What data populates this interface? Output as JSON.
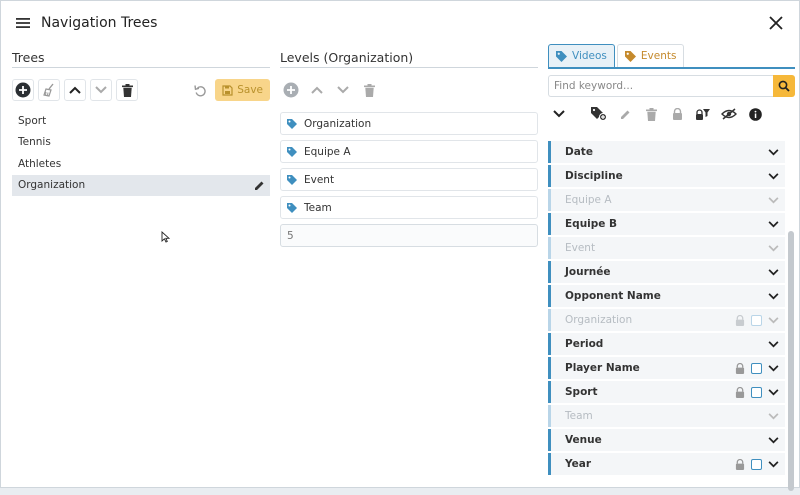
{
  "window": {
    "title": "Navigation Trees"
  },
  "trees": {
    "title": "Trees",
    "save_label": "Save",
    "items": [
      {
        "label": "Sport"
      },
      {
        "label": "Tennis"
      },
      {
        "label": "Athletes"
      },
      {
        "label": "Organization",
        "selected": true
      }
    ]
  },
  "levels": {
    "title": "Levels (Organization)",
    "items": [
      {
        "label": "Organization"
      },
      {
        "label": "Equipe A"
      },
      {
        "label": "Event"
      },
      {
        "label": "Team"
      }
    ],
    "next_input_value": "5"
  },
  "right_panel": {
    "tabs": [
      {
        "label": "Videos",
        "active": true,
        "icon": "tag-icon"
      },
      {
        "label": "Events",
        "active": false,
        "icon": "tag-icon"
      }
    ],
    "search": {
      "placeholder": "Find keyword..."
    },
    "fields": [
      {
        "label": "Date",
        "disabled": false,
        "lock": false
      },
      {
        "label": "Discipline",
        "disabled": false,
        "lock": false
      },
      {
        "label": "Equipe A",
        "disabled": true,
        "lock": false
      },
      {
        "label": "Equipe B",
        "disabled": false,
        "lock": false
      },
      {
        "label": "Event",
        "disabled": true,
        "lock": false
      },
      {
        "label": "Journée",
        "disabled": false,
        "lock": false
      },
      {
        "label": "Opponent Name",
        "disabled": false,
        "lock": false
      },
      {
        "label": "Organization",
        "disabled": true,
        "lock": true
      },
      {
        "label": "Period",
        "disabled": false,
        "lock": false
      },
      {
        "label": "Player Name",
        "disabled": false,
        "lock": true
      },
      {
        "label": "Sport",
        "disabled": false,
        "lock": true
      },
      {
        "label": "Team",
        "disabled": true,
        "lock": false
      },
      {
        "label": "Venue",
        "disabled": false,
        "lock": false
      },
      {
        "label": "Year",
        "disabled": false,
        "lock": true
      }
    ]
  },
  "colors": {
    "accent_blue": "#3f8fbf",
    "accent_orange": "#f6b83a",
    "save_bg": "#f8d58a"
  }
}
